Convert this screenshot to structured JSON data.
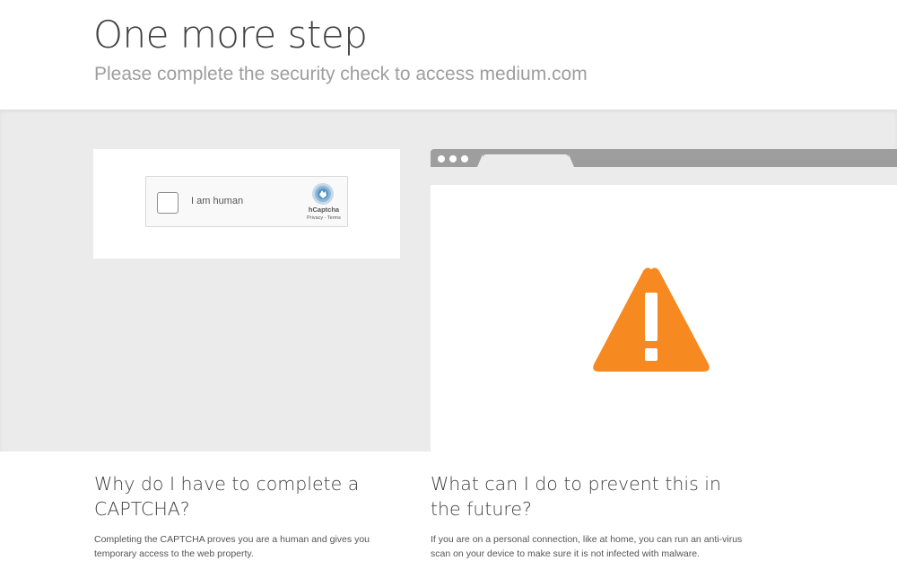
{
  "header": {
    "title": "One more step",
    "subtitle": "Please complete the security check to access medium.com"
  },
  "captcha": {
    "checkbox_label": "I am human",
    "brand": "hCaptcha",
    "privacy_link": "Privacy",
    "separator": " - ",
    "terms_link": "Terms"
  },
  "illustration": {
    "icon": "warning-triangle-icon",
    "accent_color": "#f6891f"
  },
  "info": {
    "why": {
      "heading": "Why do I have to complete a CAPTCHA?",
      "body": "Completing the CAPTCHA proves you are a human and gives you temporary access to the web property."
    },
    "prevent": {
      "heading": "What can I do to prevent this in the future?",
      "body": "If you are on a personal connection, like at home, you can run an anti-virus scan on your device to make sure it is not infected with malware."
    }
  }
}
